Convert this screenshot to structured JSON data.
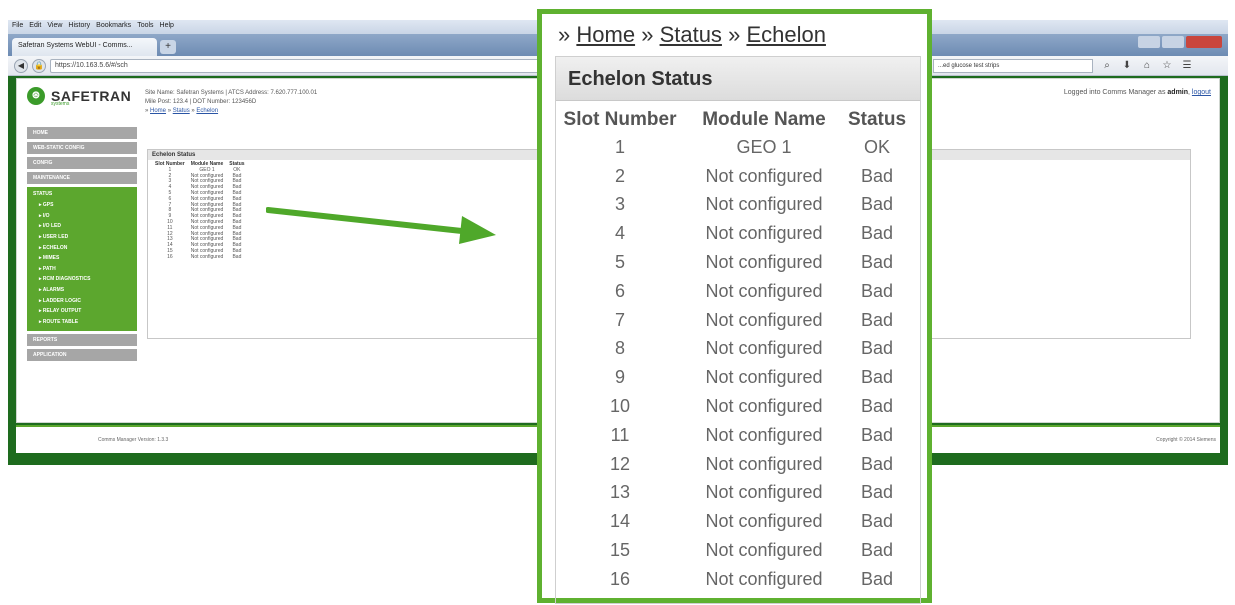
{
  "browser": {
    "menu": [
      "File",
      "Edit",
      "View",
      "History",
      "Bookmarks",
      "Tools",
      "Help"
    ],
    "tab_title": "Safetran Systems WebUI - Comms...",
    "new_tab": "+",
    "url": "https://10.163.5.6/#/sch",
    "search_text": "...ed glucose test strips",
    "back_icon": "◀",
    "toolbar_icons": [
      "⌕",
      "⬇",
      "⌂",
      "☆",
      "☰"
    ]
  },
  "app": {
    "logo": "SAFETRAN",
    "logo_sub": "systems",
    "site_line1": "Site Name: Safetran Systems  |  ATCS Address: 7.620.777.100.01",
    "site_line2": "Mile Post: 123.4            |  DOT Number: 123456D",
    "mini_breadcrumb": [
      "Home",
      "Status",
      "Echelon"
    ],
    "login_prefix": "Logged into Comms Manager as",
    "login_user": "admin",
    "logout": "logout",
    "sidebar": {
      "top_items": [
        "HOME",
        "WEB-STATIC CONFIG",
        "CONFIG",
        "MAINTENANCE"
      ],
      "status_head": "STATUS",
      "status_items": [
        "GPS",
        "I/O",
        "I/O LED",
        "USER LED",
        "ECHELON",
        "MIMES",
        "PATH",
        "RCM DIAGNOSTICS",
        "ALARMS",
        "LADDER LOGIC",
        "RELAY OUTPUT",
        "ROUTE TABLE"
      ],
      "bottom_items": [
        "REPORTS",
        "APPLICATION"
      ]
    },
    "version": "Comms Manager Version: 1.3.3",
    "copyright": "Copyright © 2014 Siemens"
  },
  "zoom": {
    "breadcrumb_prefix": "»",
    "breadcrumb": [
      "Home",
      "Status",
      "Echelon"
    ],
    "panel_title": "Echelon Status",
    "columns": [
      "Slot Number",
      "Module Name",
      "Status"
    ],
    "rows": [
      [
        "1",
        "GEO 1",
        "OK"
      ],
      [
        "2",
        "Not configured",
        "Bad"
      ],
      [
        "3",
        "Not configured",
        "Bad"
      ],
      [
        "4",
        "Not configured",
        "Bad"
      ],
      [
        "5",
        "Not configured",
        "Bad"
      ],
      [
        "6",
        "Not configured",
        "Bad"
      ],
      [
        "7",
        "Not configured",
        "Bad"
      ],
      [
        "8",
        "Not configured",
        "Bad"
      ],
      [
        "9",
        "Not configured",
        "Bad"
      ],
      [
        "10",
        "Not configured",
        "Bad"
      ],
      [
        "11",
        "Not configured",
        "Bad"
      ],
      [
        "12",
        "Not configured",
        "Bad"
      ],
      [
        "13",
        "Not configured",
        "Bad"
      ],
      [
        "14",
        "Not configured",
        "Bad"
      ],
      [
        "15",
        "Not configured",
        "Bad"
      ],
      [
        "16",
        "Not configured",
        "Bad"
      ]
    ],
    "mini_rows_status": [
      "Bad",
      "Bad",
      "Bad",
      "Bad",
      "Bad",
      "Bad",
      "Bad",
      "Bad",
      "Bad",
      "Bad",
      "Bad",
      "Bad",
      "Bad",
      "Bad",
      "Bad",
      "Bad"
    ]
  },
  "colors": {
    "accent_green": "#5fb130",
    "sidebar_green": "#5ca72e",
    "arrow_green": "#4fa82a"
  }
}
